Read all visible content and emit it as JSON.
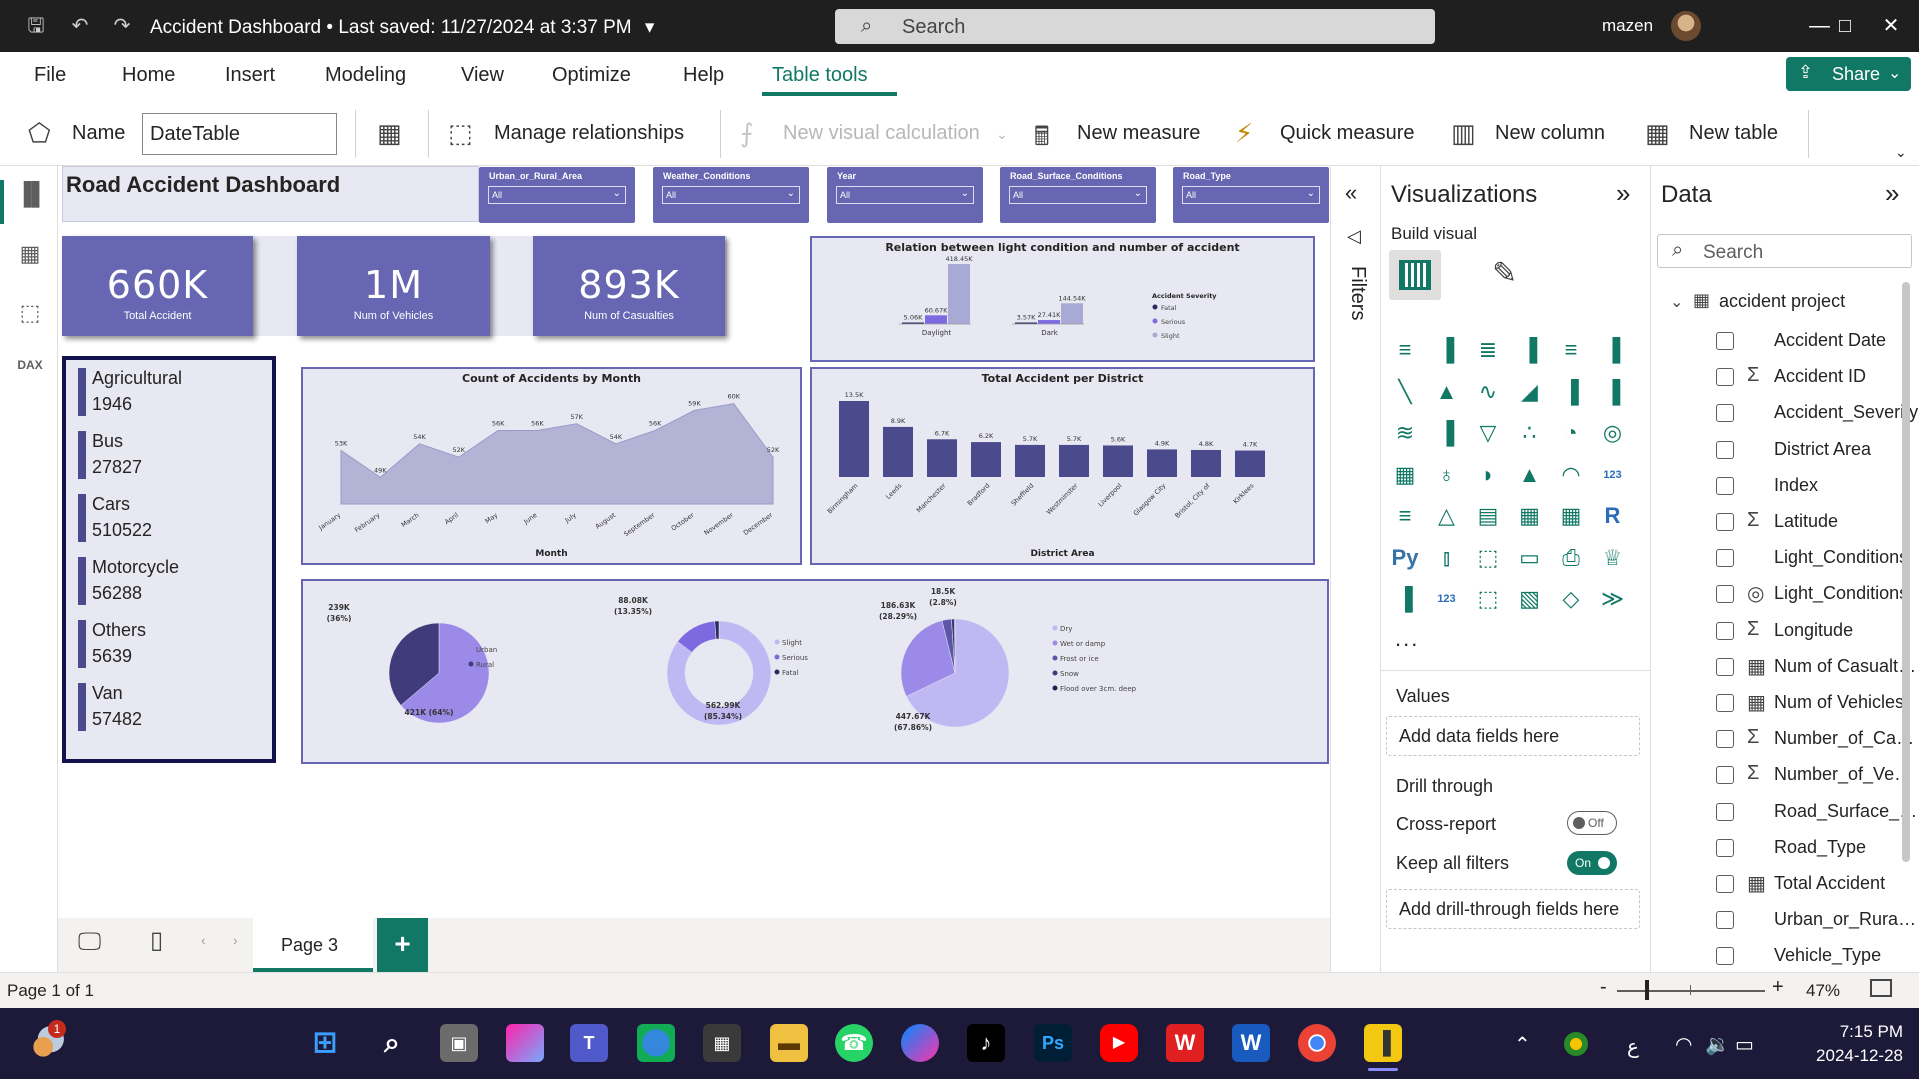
{
  "titlebar": {
    "doc_title": "Accident Dashboard",
    "save_status": "Last saved: 11/27/2024 at 3:37 PM",
    "search_label": "Search",
    "user_name": "mazen"
  },
  "menu": {
    "items": [
      "File",
      "Home",
      "Insert",
      "Modeling",
      "View",
      "Optimize",
      "Help",
      "Table tools"
    ],
    "active": "Table tools",
    "share_label": "Share"
  },
  "ribbon": {
    "name_label": "Name",
    "name_value": "DateTable",
    "manage_relationships": "Manage relationships",
    "new_visual_calculation": "New visual calculation",
    "new_measure": "New measure",
    "quick_measure": "Quick measure",
    "new_column": "New column",
    "new_table": "New table"
  },
  "report": {
    "title": "Road Accident Dashboard",
    "slicers": [
      {
        "title": "Urban_or_Rural_Area",
        "value": "All"
      },
      {
        "title": "Weather_Conditions",
        "value": "All"
      },
      {
        "title": "Year",
        "value": "All"
      },
      {
        "title": "Road_Surface_Conditions",
        "value": "All"
      },
      {
        "title": "Road_Type",
        "value": "All"
      }
    ],
    "kpis": [
      {
        "value": "660K",
        "label": "Total Accident"
      },
      {
        "value": "1M",
        "label": "Num of Vehicles"
      },
      {
        "value": "893K",
        "label": "Num of Casualties"
      }
    ],
    "vehicle_types": [
      {
        "name": "Agricultural",
        "count": "1946"
      },
      {
        "name": "Bus",
        "count": "27827"
      },
      {
        "name": "Cars",
        "count": "510522"
      },
      {
        "name": "Motorcycle",
        "count": "56288"
      },
      {
        "name": "Others",
        "count": "5639"
      },
      {
        "name": "Van",
        "count": "57482"
      }
    ]
  },
  "chart_data": [
    {
      "type": "bar",
      "title": "Relation between light condition and number of accident",
      "categories": [
        "Daylight",
        "Dark"
      ],
      "legend_title": "Accident Severity",
      "legend_placement": "right",
      "series": [
        {
          "name": "Fatal",
          "values": [
            5.06,
            3.57
          ],
          "labels": [
            "5.06K",
            "3.57K"
          ],
          "color": "#2a2a5e"
        },
        {
          "name": "Serious",
          "values": [
            60.67,
            27.41
          ],
          "labels": [
            "60.67K",
            "27.41K"
          ],
          "color": "#7d6ae0"
        },
        {
          "name": "Slight",
          "values": [
            418.45,
            144.54
          ],
          "labels": [
            "418.45K",
            "144.54K"
          ],
          "color": "#a9a9d6"
        }
      ]
    },
    {
      "type": "area",
      "title": "Count of Accidents by Month",
      "xlabel": "Month",
      "categories": [
        "January",
        "February",
        "March",
        "April",
        "May",
        "June",
        "July",
        "August",
        "September",
        "October",
        "November",
        "December"
      ],
      "values": [
        53,
        49,
        54,
        52,
        56,
        56,
        57,
        54,
        56,
        59,
        60,
        52
      ],
      "labels": [
        "53K",
        "49K",
        "54K",
        "52K",
        "56K",
        "56K",
        "57K",
        "54K",
        "56K",
        "59K",
        "60K",
        "52K"
      ],
      "ylim": [
        45,
        61
      ],
      "color": "#b3b3d6"
    },
    {
      "type": "bar",
      "title": "Total Accident per District",
      "xlabel": "District Area",
      "categories": [
        "Birmingham",
        "Leeds",
        "Manchester",
        "Bradford",
        "Sheffield",
        "Westminster",
        "Liverpool",
        "Glasgow City",
        "Bristol, City of",
        "Kirklees"
      ],
      "values": [
        13.5,
        8.9,
        6.7,
        6.2,
        5.7,
        5.7,
        5.6,
        4.9,
        4.8,
        4.7
      ],
      "labels": [
        "13.5K",
        "8.9K",
        "6.7K",
        "6.2K",
        "5.7K",
        "5.7K",
        "5.6K",
        "4.9K",
        "4.8K",
        "4.7K"
      ],
      "color": "#4a4a8c"
    },
    {
      "type": "pie",
      "categories": [
        "Urban",
        "Rural"
      ],
      "values": [
        421,
        239
      ],
      "labels": [
        "421K (64%)",
        "239K (36%)"
      ],
      "colors": [
        "#9b8ae8",
        "#403b7a"
      ],
      "legend_placement": "right"
    },
    {
      "type": "pie",
      "donut": true,
      "categories": [
        "Slight",
        "Serious",
        "Fatal"
      ],
      "values": [
        562.99,
        88.08,
        8.66
      ],
      "labels": [
        "562.99K (85.34%)",
        "88.08K (13.35%)",
        ""
      ],
      "colors": [
        "#c0b8f2",
        "#7d6ae0",
        "#2a2a5e"
      ],
      "legend_placement": "right"
    },
    {
      "type": "pie",
      "categories": [
        "Dry",
        "Wet or damp",
        "Frost or ice",
        "Snow",
        "Flood over 3cm. deep"
      ],
      "values": [
        447.67,
        186.63,
        18.5,
        6.0,
        1.0
      ],
      "labels": [
        "447.67K (67.86%)",
        "186.63K (28.29%)",
        "18.5K (2.8%)",
        "",
        ""
      ],
      "colors": [
        "#c0b8f2",
        "#9b8ae8",
        "#5d55a8",
        "#3b3b78",
        "#1f1f4d"
      ],
      "legend_placement": "right"
    }
  ],
  "filters": {
    "label": "Filters"
  },
  "visualizations": {
    "title": "Visualizations",
    "build_visual": "Build visual",
    "values_label": "Values",
    "values_placeholder": "Add data fields here",
    "drill_through": "Drill through",
    "cross_report": "Cross-report",
    "cross_report_state": "Off",
    "keep_all_filters": "Keep all filters",
    "keep_all_filters_state": "On",
    "drill_placeholder": "Add drill-through fields here",
    "more": "..."
  },
  "data_pane": {
    "title": "Data",
    "search_placeholder": "Search",
    "table_name": "accident project",
    "fields": [
      {
        "name": "Accident Date",
        "type": ""
      },
      {
        "name": "Accident ID",
        "type": "sigma"
      },
      {
        "name": "Accident_Severity",
        "type": ""
      },
      {
        "name": "District Area",
        "type": ""
      },
      {
        "name": "Index",
        "type": ""
      },
      {
        "name": "Latitude",
        "type": "sigma"
      },
      {
        "name": "Light_Conditions",
        "type": ""
      },
      {
        "name": "Light_Conditions",
        "type": "hierarchy"
      },
      {
        "name": "Longitude",
        "type": "sigma"
      },
      {
        "name": "Num of Casualties",
        "type": "measure"
      },
      {
        "name": "Num of Vehicles",
        "type": "measure"
      },
      {
        "name": "Number_of_Casualties",
        "type": "sigma"
      },
      {
        "name": "Number_of_Vehicles",
        "type": "sigma"
      },
      {
        "name": "Road_Surface_Conditions",
        "type": ""
      },
      {
        "name": "Road_Type",
        "type": ""
      },
      {
        "name": "Total Accident",
        "type": "measure"
      },
      {
        "name": "Urban_or_Rural_Area",
        "type": ""
      },
      {
        "name": "Vehicle_Type",
        "type": ""
      }
    ]
  },
  "pages": {
    "current": "Page 3",
    "add": "+"
  },
  "status": {
    "page_info": "Page 1 of 1",
    "zoom": "47%"
  },
  "taskbar": {
    "time": "7:15 PM",
    "date": "2024-12-28",
    "weather_badge": "1",
    "lang": "ع"
  },
  "colors": {
    "accent": "#117865",
    "report_purple": "#6666b2",
    "taskbar": "#1c1a38"
  }
}
